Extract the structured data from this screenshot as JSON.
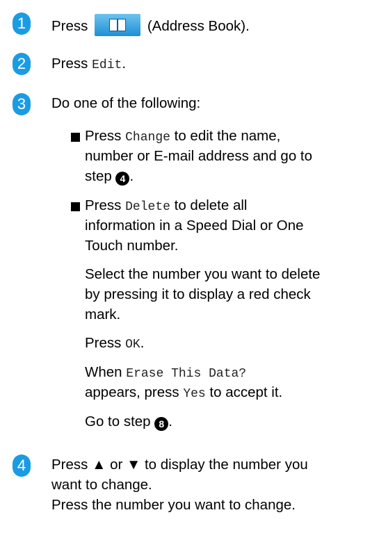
{
  "steps": {
    "s1": {
      "number": "1",
      "press": "Press",
      "icon": "address-book-icon",
      "label": "(Address Book)."
    },
    "s2": {
      "number": "2",
      "press": "Press",
      "key": "Edit",
      "end": "."
    },
    "s3": {
      "number": "3",
      "text": "Do one of the following:",
      "b1": {
        "l1a": "Press",
        "l1key": "Change",
        "l1b": "to edit the name,",
        "l2": "number or E-mail address and go to",
        "l3a": "step",
        "l3ref": "4",
        "l3b": "."
      },
      "b2": {
        "l1a": "Press",
        "l1key": "Delete",
        "l1b": "to delete all",
        "l2": "information in a Speed Dial or One",
        "l3": "Touch number.",
        "p1l1": "Select the number you want to delete",
        "p1l2": "by pressing it to display a red check",
        "p1l3": "mark.",
        "p2a": "Press",
        "p2key": "OK",
        "p2b": ".",
        "p3a": "When",
        "p3key": "Erase This Data?",
        "p3l2key": "appears, press",
        "p3yes": "Yes",
        "p3l2b": "to accept it.",
        "p4a": "Go to step",
        "p4ref": "8",
        "p4b": "."
      }
    },
    "s4": {
      "number": "4",
      "l1": "Press ▲ or ▼ to display the number you",
      "l2": "want to change.",
      "l3": "Press the number you want to change."
    }
  },
  "colors": {
    "badge": "#1b9ce2"
  }
}
